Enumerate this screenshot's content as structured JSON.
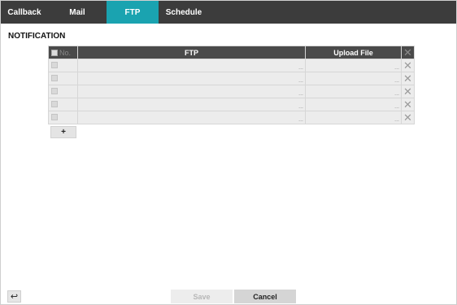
{
  "tabs": [
    {
      "label": "Callback",
      "active": false
    },
    {
      "label": "Mail",
      "active": false
    },
    {
      "label": "FTP",
      "active": true
    },
    {
      "label": "Schedule",
      "active": false
    }
  ],
  "section_title": "NOTIFICATION",
  "table": {
    "columns": {
      "no": "No.",
      "ftp": "FTP",
      "upload_file": "Upload File"
    },
    "delete_all_icon": "close-icon",
    "row_count": 5,
    "ellipsis": "..."
  },
  "add_button": {
    "label": "+"
  },
  "back_button": {
    "icon": "undo-arrow-icon",
    "glyph": "↩"
  },
  "footer": {
    "save_label": "Save",
    "cancel_label": "Cancel"
  },
  "colors": {
    "tabbar_bg": "#3c3c3c",
    "tab_active_bg": "#1aa3b0",
    "table_header_bg": "#4a4a4a",
    "row_bg": "#ececec"
  }
}
